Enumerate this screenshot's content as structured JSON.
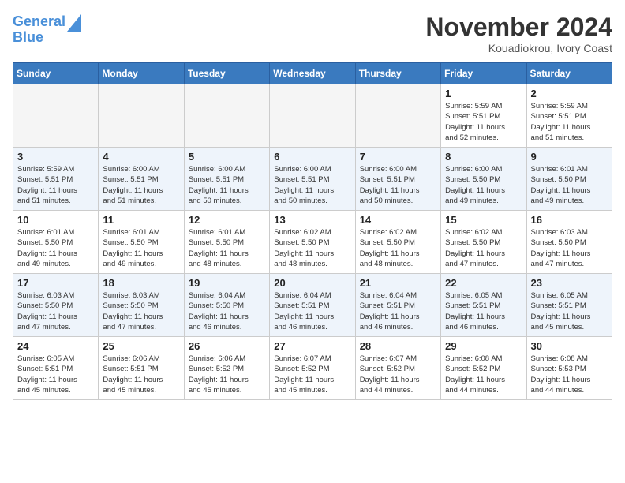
{
  "header": {
    "logo_line1": "General",
    "logo_line2": "Blue",
    "month": "November 2024",
    "location": "Kouadiokrou, Ivory Coast"
  },
  "weekdays": [
    "Sunday",
    "Monday",
    "Tuesday",
    "Wednesday",
    "Thursday",
    "Friday",
    "Saturday"
  ],
  "weeks": [
    [
      {
        "day": "",
        "info": ""
      },
      {
        "day": "",
        "info": ""
      },
      {
        "day": "",
        "info": ""
      },
      {
        "day": "",
        "info": ""
      },
      {
        "day": "",
        "info": ""
      },
      {
        "day": "1",
        "info": "Sunrise: 5:59 AM\nSunset: 5:51 PM\nDaylight: 11 hours\nand 52 minutes."
      },
      {
        "day": "2",
        "info": "Sunrise: 5:59 AM\nSunset: 5:51 PM\nDaylight: 11 hours\nand 51 minutes."
      }
    ],
    [
      {
        "day": "3",
        "info": "Sunrise: 5:59 AM\nSunset: 5:51 PM\nDaylight: 11 hours\nand 51 minutes."
      },
      {
        "day": "4",
        "info": "Sunrise: 6:00 AM\nSunset: 5:51 PM\nDaylight: 11 hours\nand 51 minutes."
      },
      {
        "day": "5",
        "info": "Sunrise: 6:00 AM\nSunset: 5:51 PM\nDaylight: 11 hours\nand 50 minutes."
      },
      {
        "day": "6",
        "info": "Sunrise: 6:00 AM\nSunset: 5:51 PM\nDaylight: 11 hours\nand 50 minutes."
      },
      {
        "day": "7",
        "info": "Sunrise: 6:00 AM\nSunset: 5:51 PM\nDaylight: 11 hours\nand 50 minutes."
      },
      {
        "day": "8",
        "info": "Sunrise: 6:00 AM\nSunset: 5:50 PM\nDaylight: 11 hours\nand 49 minutes."
      },
      {
        "day": "9",
        "info": "Sunrise: 6:01 AM\nSunset: 5:50 PM\nDaylight: 11 hours\nand 49 minutes."
      }
    ],
    [
      {
        "day": "10",
        "info": "Sunrise: 6:01 AM\nSunset: 5:50 PM\nDaylight: 11 hours\nand 49 minutes."
      },
      {
        "day": "11",
        "info": "Sunrise: 6:01 AM\nSunset: 5:50 PM\nDaylight: 11 hours\nand 49 minutes."
      },
      {
        "day": "12",
        "info": "Sunrise: 6:01 AM\nSunset: 5:50 PM\nDaylight: 11 hours\nand 48 minutes."
      },
      {
        "day": "13",
        "info": "Sunrise: 6:02 AM\nSunset: 5:50 PM\nDaylight: 11 hours\nand 48 minutes."
      },
      {
        "day": "14",
        "info": "Sunrise: 6:02 AM\nSunset: 5:50 PM\nDaylight: 11 hours\nand 48 minutes."
      },
      {
        "day": "15",
        "info": "Sunrise: 6:02 AM\nSunset: 5:50 PM\nDaylight: 11 hours\nand 47 minutes."
      },
      {
        "day": "16",
        "info": "Sunrise: 6:03 AM\nSunset: 5:50 PM\nDaylight: 11 hours\nand 47 minutes."
      }
    ],
    [
      {
        "day": "17",
        "info": "Sunrise: 6:03 AM\nSunset: 5:50 PM\nDaylight: 11 hours\nand 47 minutes."
      },
      {
        "day": "18",
        "info": "Sunrise: 6:03 AM\nSunset: 5:50 PM\nDaylight: 11 hours\nand 47 minutes."
      },
      {
        "day": "19",
        "info": "Sunrise: 6:04 AM\nSunset: 5:50 PM\nDaylight: 11 hours\nand 46 minutes."
      },
      {
        "day": "20",
        "info": "Sunrise: 6:04 AM\nSunset: 5:51 PM\nDaylight: 11 hours\nand 46 minutes."
      },
      {
        "day": "21",
        "info": "Sunrise: 6:04 AM\nSunset: 5:51 PM\nDaylight: 11 hours\nand 46 minutes."
      },
      {
        "day": "22",
        "info": "Sunrise: 6:05 AM\nSunset: 5:51 PM\nDaylight: 11 hours\nand 46 minutes."
      },
      {
        "day": "23",
        "info": "Sunrise: 6:05 AM\nSunset: 5:51 PM\nDaylight: 11 hours\nand 45 minutes."
      }
    ],
    [
      {
        "day": "24",
        "info": "Sunrise: 6:05 AM\nSunset: 5:51 PM\nDaylight: 11 hours\nand 45 minutes."
      },
      {
        "day": "25",
        "info": "Sunrise: 6:06 AM\nSunset: 5:51 PM\nDaylight: 11 hours\nand 45 minutes."
      },
      {
        "day": "26",
        "info": "Sunrise: 6:06 AM\nSunset: 5:52 PM\nDaylight: 11 hours\nand 45 minutes."
      },
      {
        "day": "27",
        "info": "Sunrise: 6:07 AM\nSunset: 5:52 PM\nDaylight: 11 hours\nand 45 minutes."
      },
      {
        "day": "28",
        "info": "Sunrise: 6:07 AM\nSunset: 5:52 PM\nDaylight: 11 hours\nand 44 minutes."
      },
      {
        "day": "29",
        "info": "Sunrise: 6:08 AM\nSunset: 5:52 PM\nDaylight: 11 hours\nand 44 minutes."
      },
      {
        "day": "30",
        "info": "Sunrise: 6:08 AM\nSunset: 5:53 PM\nDaylight: 11 hours\nand 44 minutes."
      }
    ]
  ]
}
